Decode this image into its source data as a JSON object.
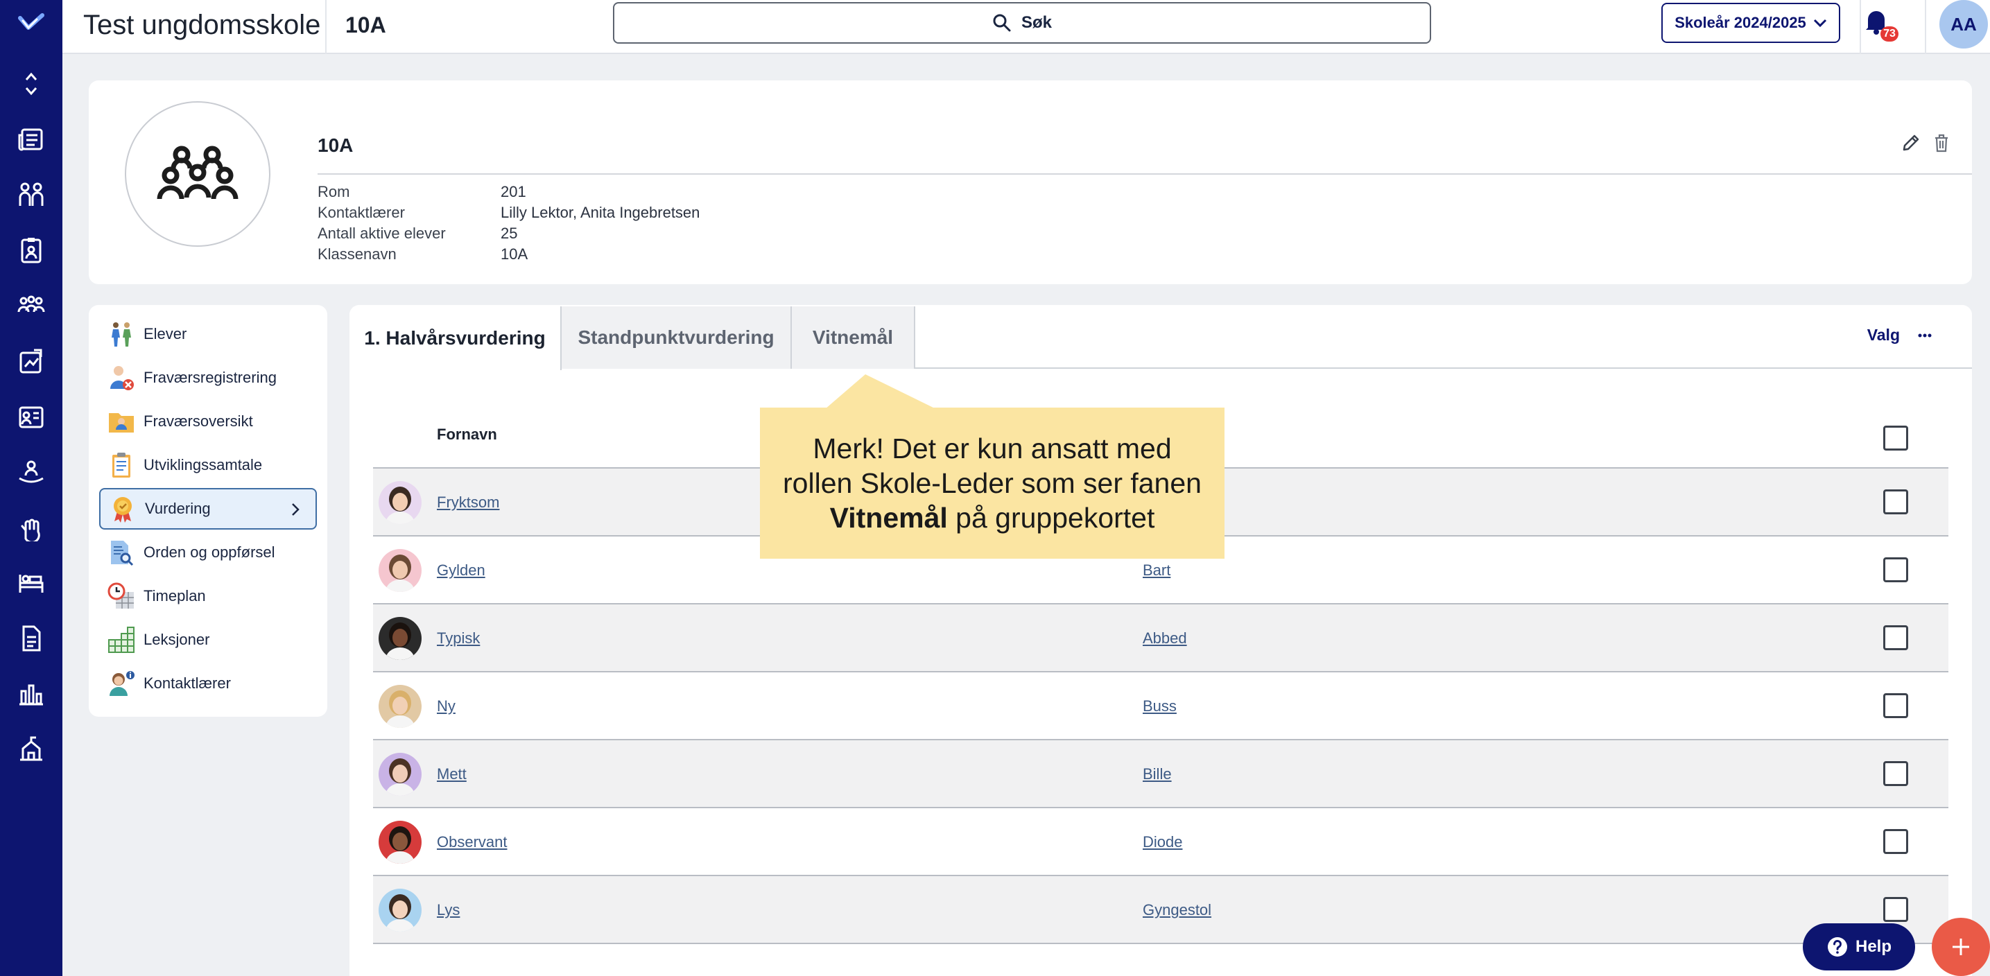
{
  "topbar": {
    "school_name": "Test ungdomsskole",
    "group_code": "10A",
    "search_label": "Søk",
    "school_year_label": "Skoleår 2024/2025",
    "notification_count": "73",
    "user_initials": "AA"
  },
  "rail": {
    "icons": [
      "logo-icon",
      "collapse-icon",
      "news-icon",
      "students-icon",
      "contact-card-icon",
      "groups-icon",
      "assessment-icon",
      "calendar-icon",
      "person-hand-icon",
      "raised-hand-icon",
      "bed-icon",
      "document-icon",
      "bar-chart-icon",
      "school-icon"
    ]
  },
  "group": {
    "name": "10A",
    "fields": [
      {
        "label": "Rom",
        "value": "201"
      },
      {
        "label": "Kontaktlærer",
        "value": "Lilly Lektor, Anita Ingebretsen"
      },
      {
        "label": "Antall aktive elever",
        "value": "25"
      },
      {
        "label": "Klassenavn",
        "value": "10A"
      }
    ]
  },
  "menu": {
    "items": [
      {
        "label": "Elever",
        "icon": "students-walking-icon"
      },
      {
        "label": "Fraværsregistrering",
        "icon": "absence-register-icon"
      },
      {
        "label": "Fraværsoversikt",
        "icon": "absence-folder-icon"
      },
      {
        "label": "Utviklingssamtale",
        "icon": "clipboard-icon"
      },
      {
        "label": "Vurdering",
        "icon": "medal-icon",
        "active": true
      },
      {
        "label": "Orden og oppførsel",
        "icon": "document-search-icon"
      },
      {
        "label": "Timeplan",
        "icon": "timetable-icon"
      },
      {
        "label": "Leksjoner",
        "icon": "grid-icon"
      },
      {
        "label": "Kontaktlærer",
        "icon": "teacher-info-icon"
      }
    ]
  },
  "tabs": [
    {
      "label": "1. Halvårsvurdering",
      "active": true
    },
    {
      "label": "Standpunktvurdering",
      "active": false
    },
    {
      "label": "Vitnemål",
      "active": false
    }
  ],
  "valg_label": "Valg",
  "table": {
    "header_first_name": "Fornavn",
    "rows": [
      {
        "first": "Fryktsom",
        "last": "",
        "skin": "#f2cdb3",
        "hair": "#3a2a22",
        "bg": "#e8d8f0"
      },
      {
        "first": "Gylden",
        "last": "Bart",
        "skin": "#f0c9b0",
        "hair": "#6b4a35",
        "bg": "#f5c6cf"
      },
      {
        "first": "Typisk",
        "last": "Abbed",
        "skin": "#7a4a33",
        "hair": "#1a120e",
        "bg": "#2b2b2b"
      },
      {
        "first": "Ny",
        "last": "Buss",
        "skin": "#f1d0b5",
        "hair": "#d9b06a",
        "bg": "#e2c9a4"
      },
      {
        "first": "Mett",
        "last": "Bille",
        "skin": "#f0cdb8",
        "hair": "#4b3325",
        "bg": "#c9b3e6"
      },
      {
        "first": "Observant",
        "last": "Diode",
        "skin": "#8a573c",
        "hair": "#1d1410",
        "bg": "#d63b3b"
      },
      {
        "first": "Lys",
        "last": "Gyngestol",
        "skin": "#f3d3bd",
        "hair": "#3b2b22",
        "bg": "#a9d3f0"
      }
    ]
  },
  "tooltip": {
    "line1": "Merk! Det er kun ansatt med",
    "line2": "rollen Skole-Leder som ser fanen",
    "bold": "Vitnemål",
    "line3_rest": " på gruppekortet"
  },
  "help_label": "Help",
  "colors": {
    "rail": "#0d1570",
    "accent": "#0d1570",
    "tooltip_bg": "#fbe5a2",
    "fab": "#ea5a47",
    "link": "#3d5a85"
  }
}
